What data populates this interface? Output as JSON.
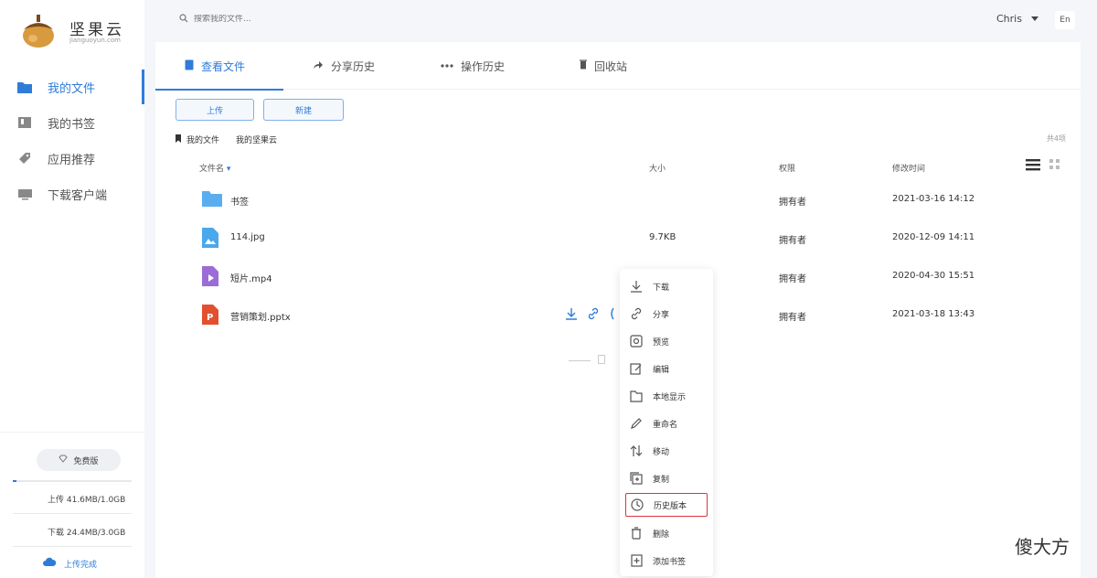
{
  "app": {
    "name": "坚果云",
    "domain": "jianguoyun.com"
  },
  "sidebar": {
    "items": [
      {
        "label": "我的文件",
        "icon": "folder-icon"
      },
      {
        "label": "我的书签",
        "icon": "bookmark-icon"
      },
      {
        "label": "应用推荐",
        "icon": "tag-icon"
      },
      {
        "label": "下载客户端",
        "icon": "monitor-icon"
      }
    ],
    "plan_label": "免费版",
    "upload_stat": "上传 41.6MB/1.0GB",
    "download_stat": "下载 24.4MB/3.0GB",
    "upload_done": "上传完成"
  },
  "topbar": {
    "search_placeholder": "搜索我的文件...",
    "user": "Chris",
    "lang": "En"
  },
  "tabs": [
    {
      "label": "查看文件"
    },
    {
      "label": "分享历史"
    },
    {
      "label": "操作历史"
    },
    {
      "label": "回收站"
    }
  ],
  "toolbar": {
    "upload_label": "上传",
    "new_label": "新建"
  },
  "breadcrumb": {
    "root": "我的文件",
    "current": "我的坚果云"
  },
  "count_label": "共4项",
  "table": {
    "headers": {
      "name": "文件名",
      "size": "大小",
      "perm": "权限",
      "modified": "修改时间"
    },
    "rows": [
      {
        "name": "书签",
        "size": "",
        "perm": "拥有者",
        "modified": "2021-03-16 14:12",
        "type": "folder"
      },
      {
        "name": "114.jpg",
        "size": "9.7KB",
        "perm": "拥有者",
        "modified": "2020-12-09 14:11",
        "type": "image"
      },
      {
        "name": "短片.mp4",
        "size": "",
        "perm": "拥有者",
        "modified": "2020-04-30 15:51",
        "type": "video"
      },
      {
        "name": "营销策划.pptx",
        "size": "",
        "perm": "拥有者",
        "modified": "2021-03-18 13:43",
        "type": "ppt"
      }
    ]
  },
  "context_menu": [
    {
      "label": "下载",
      "icon": "download-icon"
    },
    {
      "label": "分享",
      "icon": "link-icon"
    },
    {
      "label": "预览",
      "icon": "preview-icon"
    },
    {
      "label": "编辑",
      "icon": "edit-icon"
    },
    {
      "label": "本地显示",
      "icon": "folder-open-icon"
    },
    {
      "label": "重命名",
      "icon": "pencil-icon"
    },
    {
      "label": "移动",
      "icon": "move-icon"
    },
    {
      "label": "复制",
      "icon": "copy-icon"
    },
    {
      "label": "历史版本",
      "icon": "history-icon"
    },
    {
      "label": "删除",
      "icon": "trash-icon"
    },
    {
      "label": "添加书签",
      "icon": "add-bookmark-icon"
    }
  ],
  "watermark": "傻大方",
  "colors": {
    "accent": "#2f7cd8",
    "highlight": "#d9363e",
    "brand_logo": "#c9872e"
  }
}
